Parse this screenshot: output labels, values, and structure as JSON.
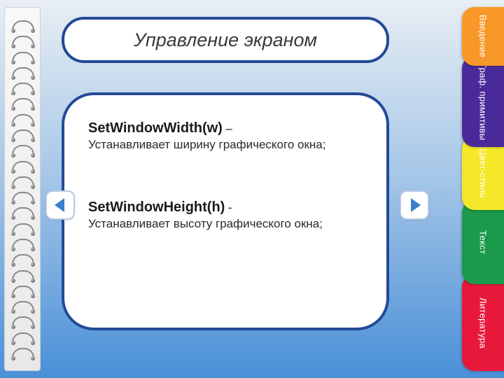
{
  "title": "Управление экраном",
  "functions": [
    {
      "name": "SetWindowWidth(w)",
      "sep": " – ",
      "desc": "Устанавливает ширину графического окна;"
    },
    {
      "name": "SetWindowHeight(h)",
      "sep": "  -",
      "desc": "Устанавливает высоту графического окна;"
    }
  ],
  "tabs": [
    {
      "label": "Введение"
    },
    {
      "label": "Граф. примитивы"
    },
    {
      "label": "Цвет-стиль"
    },
    {
      "label": "Текст"
    },
    {
      "label": "Литература"
    }
  ]
}
